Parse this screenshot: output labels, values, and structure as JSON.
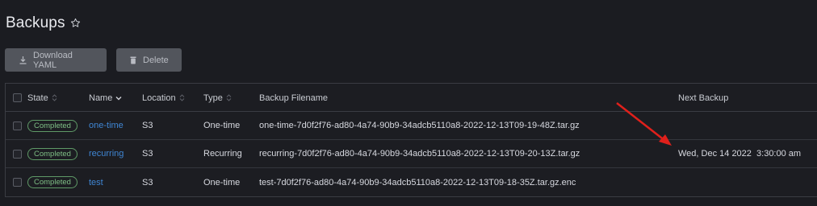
{
  "page": {
    "title": "Backups"
  },
  "icons": {
    "favorite": "star-outline-icon",
    "download": "download-icon",
    "delete": "trash-icon",
    "sort": "sort-icon",
    "annotation": "red-arrow"
  },
  "toolbar": {
    "download_label": "Download YAML",
    "delete_label": "Delete"
  },
  "table": {
    "columns": [
      "State",
      "Name",
      "Location",
      "Type",
      "Backup Filename",
      "Next Backup"
    ],
    "rows": [
      {
        "state": "Completed",
        "name": "one-time",
        "location": "S3",
        "type": "One-time",
        "filename": "one-time-7d0f2f76-ad80-4a74-90b9-34adcb5110a8-2022-12-13T09-19-48Z.tar.gz",
        "next_backup": ""
      },
      {
        "state": "Completed",
        "name": "recurring",
        "location": "S3",
        "type": "Recurring",
        "filename": "recurring-7d0f2f76-ad80-4a74-90b9-34adcb5110a8-2022-12-13T09-20-13Z.tar.gz",
        "next_backup": "Wed, Dec 14 2022  3:30:00 am"
      },
      {
        "state": "Completed",
        "name": "test",
        "location": "S3",
        "type": "One-time",
        "filename": "test-7d0f2f76-ad80-4a74-90b9-34adcb5110a8-2022-12-13T09-18-35Z.tar.gz.enc",
        "next_backup": ""
      }
    ]
  },
  "colors": {
    "background": "#1b1c21",
    "link": "#3f86d4",
    "status_completed": "#7fbf85",
    "button_bg": "#52555c",
    "annotation": "#e0201b"
  }
}
